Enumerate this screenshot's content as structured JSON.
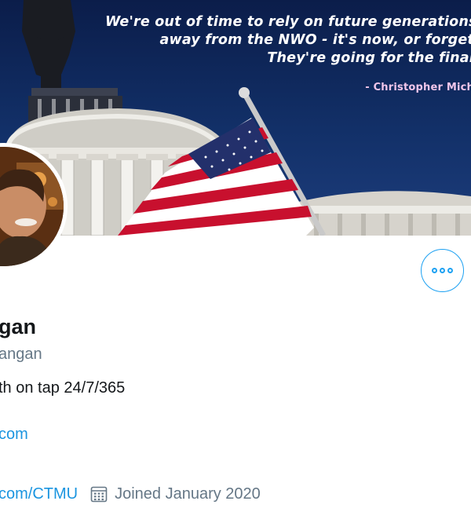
{
  "banner": {
    "quote_lines": [
      "We're out of time to rely on future generations",
      "away from the NWO - it's now, or forget",
      "They're going for the final"
    ],
    "attribution": "- Christopher Mich"
  },
  "actions": {
    "more_icon": "more-horizontal-icon"
  },
  "profile": {
    "display_name": "gan",
    "handle": "angan",
    "bio": "th on tap 24/7/365",
    "website": "com",
    "location_link": "com/CTMU",
    "joined_icon": "calendar-icon",
    "joined": "Joined January 2020"
  },
  "colors": {
    "accent": "#1da1f2",
    "link": "#1b95e0",
    "secondary_text": "#657786",
    "primary_text": "#14171a"
  }
}
